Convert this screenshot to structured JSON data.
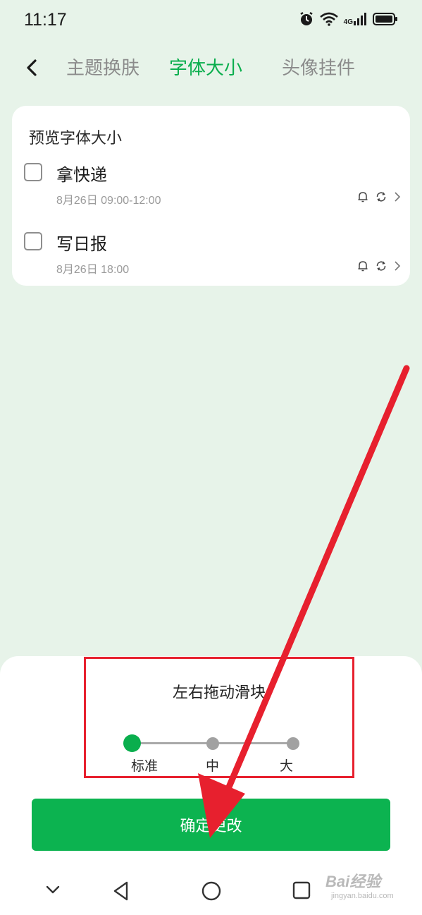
{
  "status_bar": {
    "time": "11:17",
    "network_label": "4G",
    "icons": [
      "alarm-icon",
      "wifi-icon",
      "cellular-signal-icon",
      "battery-icon"
    ]
  },
  "top_nav": {
    "back_icon": "chevron-left-icon",
    "tabs": [
      {
        "label": "主题换肤",
        "active": false
      },
      {
        "label": "字体大小",
        "active": true
      },
      {
        "label": "头像挂件",
        "active": false
      }
    ]
  },
  "preview": {
    "title": "预览字体大小",
    "tasks": [
      {
        "title": "拿快递",
        "date": "8月26日 09:00-12:00",
        "checked": false
      },
      {
        "title": "写日报",
        "date": "8月26日 18:00",
        "checked": false
      }
    ]
  },
  "font_size_slider": {
    "hint": "左右拖动滑块",
    "options": [
      "标准",
      "中",
      "大"
    ],
    "selected": "标准"
  },
  "confirm_button": {
    "label": "确定更改"
  },
  "watermark": {
    "main": "Bai经验",
    "sub": "jingyan.baidu.com"
  },
  "colors": {
    "accent": "#0aae4d",
    "page_bg": "#e7f3e9",
    "annotation": "#e7202e"
  }
}
